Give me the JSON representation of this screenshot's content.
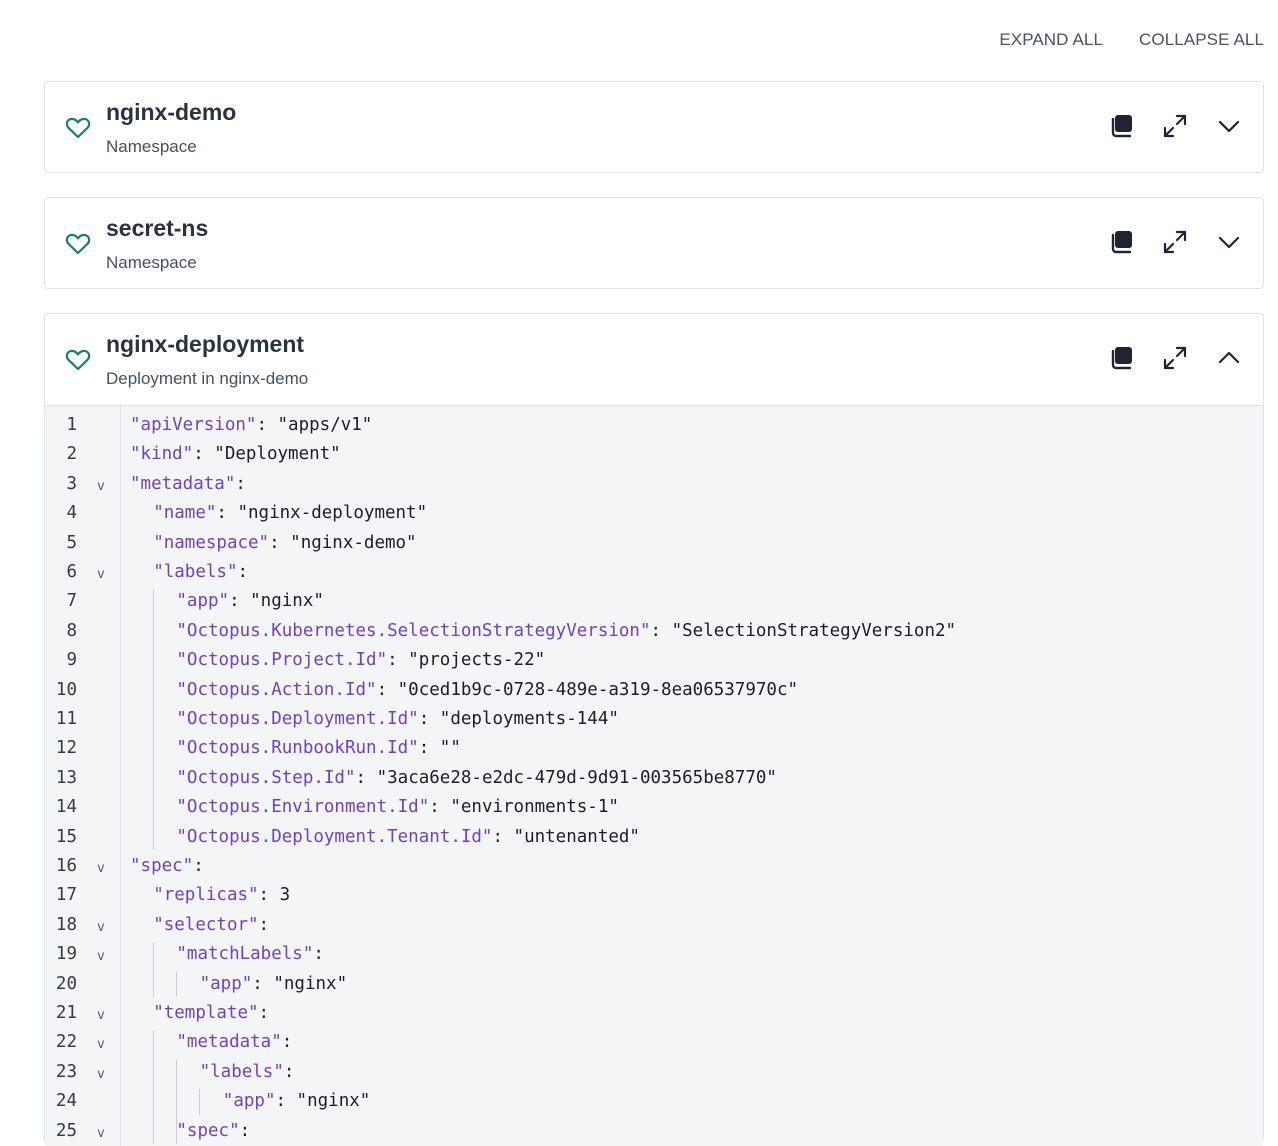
{
  "toolbar": {
    "expand_all": "EXPAND ALL",
    "collapse_all": "COLLAPSE ALL"
  },
  "colors": {
    "healthy": "#1c7f66",
    "icon": "#1f2430",
    "key": "#6f42c1"
  },
  "resources": [
    {
      "name": "nginx-demo",
      "kind": "Namespace",
      "expanded": false
    },
    {
      "name": "secret-ns",
      "kind": "Namespace",
      "expanded": false
    },
    {
      "name": "nginx-deployment",
      "kind": "Deployment in nginx-demo",
      "expanded": true
    }
  ],
  "icons": {
    "status": "heart-icon",
    "copy": "copy-icon",
    "expand": "expand-icon",
    "chevron_down": "chevron-down-icon",
    "chevron_up": "chevron-up-icon"
  },
  "code_lines": [
    {
      "n": "1",
      "indent": 0,
      "key": "\"apiVersion\"",
      "rest": ": \"apps/v1\"",
      "fold": ""
    },
    {
      "n": "2",
      "indent": 0,
      "key": "\"kind\"",
      "rest": ": \"Deployment\"",
      "fold": ""
    },
    {
      "n": "3",
      "indent": 0,
      "key": "\"metadata\"",
      "rest": ":",
      "fold": "v"
    },
    {
      "n": "4",
      "indent": 1,
      "key": "\"name\"",
      "rest": ": \"nginx-deployment\"",
      "fold": ""
    },
    {
      "n": "5",
      "indent": 1,
      "key": "\"namespace\"",
      "rest": ": \"nginx-demo\"",
      "fold": ""
    },
    {
      "n": "6",
      "indent": 1,
      "key": "\"labels\"",
      "rest": ":",
      "fold": "v"
    },
    {
      "n": "7",
      "indent": 2,
      "key": "\"app\"",
      "rest": ": \"nginx\"",
      "fold": ""
    },
    {
      "n": "8",
      "indent": 2,
      "key": "\"Octopus.Kubernetes.SelectionStrategyVersion\"",
      "rest": ": \"SelectionStrategyVersion2\"",
      "fold": ""
    },
    {
      "n": "9",
      "indent": 2,
      "key": "\"Octopus.Project.Id\"",
      "rest": ": \"projects-22\"",
      "fold": ""
    },
    {
      "n": "10",
      "indent": 2,
      "key": "\"Octopus.Action.Id\"",
      "rest": ": \"0ced1b9c-0728-489e-a319-8ea06537970c\"",
      "fold": ""
    },
    {
      "n": "11",
      "indent": 2,
      "key": "\"Octopus.Deployment.Id\"",
      "rest": ": \"deployments-144\"",
      "fold": ""
    },
    {
      "n": "12",
      "indent": 2,
      "key": "\"Octopus.RunbookRun.Id\"",
      "rest": ": \"\"",
      "fold": ""
    },
    {
      "n": "13",
      "indent": 2,
      "key": "\"Octopus.Step.Id\"",
      "rest": ": \"3aca6e28-e2dc-479d-9d91-003565be8770\"",
      "fold": ""
    },
    {
      "n": "14",
      "indent": 2,
      "key": "\"Octopus.Environment.Id\"",
      "rest": ": \"environments-1\"",
      "fold": ""
    },
    {
      "n": "15",
      "indent": 2,
      "key": "\"Octopus.Deployment.Tenant.Id\"",
      "rest": ": \"untenanted\"",
      "fold": ""
    },
    {
      "n": "16",
      "indent": 0,
      "key": "\"spec\"",
      "rest": ":",
      "fold": "v"
    },
    {
      "n": "17",
      "indent": 1,
      "key": "\"replicas\"",
      "rest": ": 3",
      "fold": ""
    },
    {
      "n": "18",
      "indent": 1,
      "key": "\"selector\"",
      "rest": ":",
      "fold": "v"
    },
    {
      "n": "19",
      "indent": 2,
      "key": "\"matchLabels\"",
      "rest": ":",
      "fold": "v"
    },
    {
      "n": "20",
      "indent": 3,
      "key": "\"app\"",
      "rest": ": \"nginx\"",
      "fold": ""
    },
    {
      "n": "21",
      "indent": 1,
      "key": "\"template\"",
      "rest": ":",
      "fold": "v"
    },
    {
      "n": "22",
      "indent": 2,
      "key": "\"metadata\"",
      "rest": ":",
      "fold": "v"
    },
    {
      "n": "23",
      "indent": 3,
      "key": "\"labels\"",
      "rest": ":",
      "fold": "v"
    },
    {
      "n": "24",
      "indent": 4,
      "key": "\"app\"",
      "rest": ": \"nginx\"",
      "fold": ""
    },
    {
      "n": "25",
      "indent": 2,
      "key": "\"spec\"",
      "rest": ":",
      "fold": "v"
    }
  ]
}
